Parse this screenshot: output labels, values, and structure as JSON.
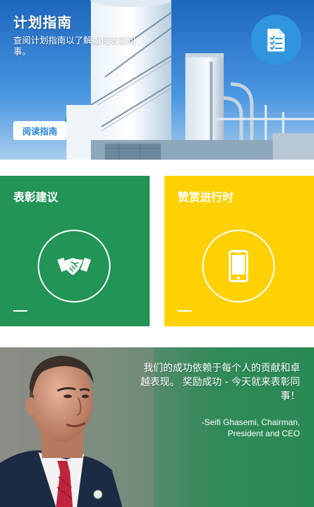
{
  "hero": {
    "title": "计划指南",
    "description": "查阅计划指南以了解如何表彰同事。",
    "button_label": "阅读指南",
    "icon": "checklist-document-icon"
  },
  "tiles": [
    {
      "title": "表彰建议",
      "icon": "handshake-icon",
      "color": "#229456"
    },
    {
      "title": "赞赏进行时",
      "icon": "smartphone-icon",
      "color": "#ffd100"
    }
  ],
  "quote": {
    "text": "我们的成功依赖于每个人的贡献和卓越表现。 奖励成功 - 今天就来表彰同事！",
    "attribution_line1": "-Seifi Ghasemi, Chairman,",
    "attribution_line2": "President and CEO"
  },
  "colors": {
    "accent_blue": "#2f95dd",
    "button_text": "#2a86d6"
  }
}
